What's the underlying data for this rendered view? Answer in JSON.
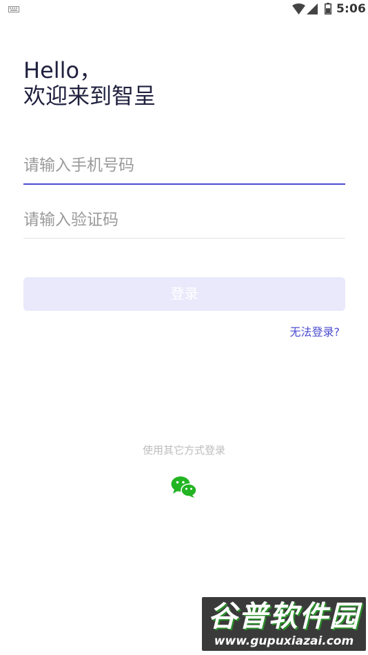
{
  "status_bar": {
    "time": "5:06",
    "icons": [
      "keyboard-icon",
      "wifi-icon",
      "signal-icon",
      "battery-icon"
    ]
  },
  "greeting": {
    "line1": "Hello，",
    "line2": "欢迎来到智呈"
  },
  "form": {
    "phone_placeholder": "请输入手机号码",
    "code_placeholder": "请输入验证码",
    "login_label": "登录",
    "help_link": "无法登录?"
  },
  "other_login": {
    "label": "使用其它方式登录",
    "icon": "wechat-icon"
  },
  "watermark": {
    "title": "谷普软件园",
    "url": "www.gupuxiazai.com"
  },
  "colors": {
    "accent": "#4a4bd0",
    "button_disabled": "#e9e9fb",
    "wechat": "#22b422"
  }
}
